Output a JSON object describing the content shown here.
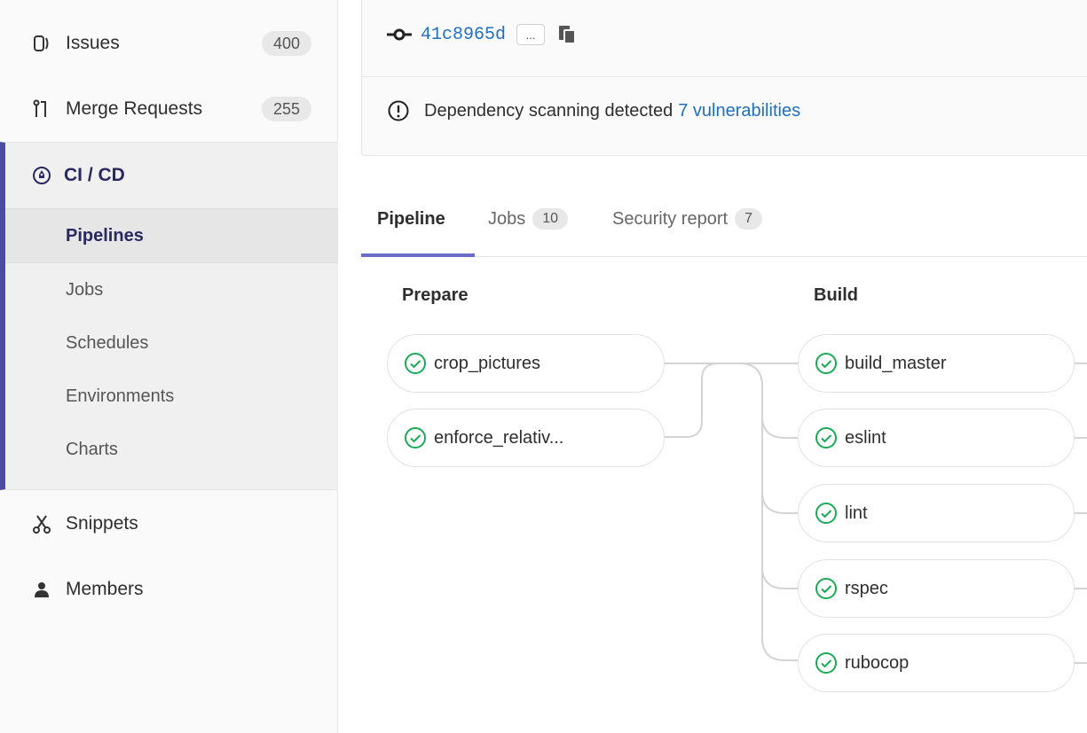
{
  "sidebar": {
    "issues": {
      "label": "Issues",
      "count": "400",
      "icon": "issues-icon"
    },
    "merge_requests": {
      "label": "Merge Requests",
      "count": "255",
      "icon": "merge-request-icon"
    },
    "cicd": {
      "label": "CI / CD",
      "icon": "rocket-icon",
      "items": [
        {
          "label": "Pipelines",
          "active": true
        },
        {
          "label": "Jobs"
        },
        {
          "label": "Schedules"
        },
        {
          "label": "Environments"
        },
        {
          "label": "Charts"
        }
      ]
    },
    "snippets": {
      "label": "Snippets",
      "icon": "scissors-icon"
    },
    "members": {
      "label": "Members",
      "icon": "user-icon"
    }
  },
  "commit": {
    "sha": "41c8965d",
    "ellipsis": "...",
    "icons": [
      "commit-icon",
      "copy-icon"
    ]
  },
  "security_notice": {
    "text": "Dependency scanning detected",
    "link": "7 vulnerabilities",
    "icon": "warning-circle-icon"
  },
  "tabs": [
    {
      "label": "Pipeline",
      "active": true
    },
    {
      "label": "Jobs",
      "count": "10"
    },
    {
      "label": "Security report",
      "count": "7"
    }
  ],
  "stages": [
    {
      "title": "Prepare",
      "jobs": [
        "crop_pictures",
        "enforce_relativ..."
      ]
    },
    {
      "title": "Build",
      "jobs": [
        "build_master",
        "eslint",
        "lint",
        "rspec",
        "rubocop"
      ]
    }
  ],
  "colors": {
    "accent": "#4b4ba3",
    "link": "#1f6fbf",
    "success": "#1aaa55",
    "active_text": "#292961"
  }
}
